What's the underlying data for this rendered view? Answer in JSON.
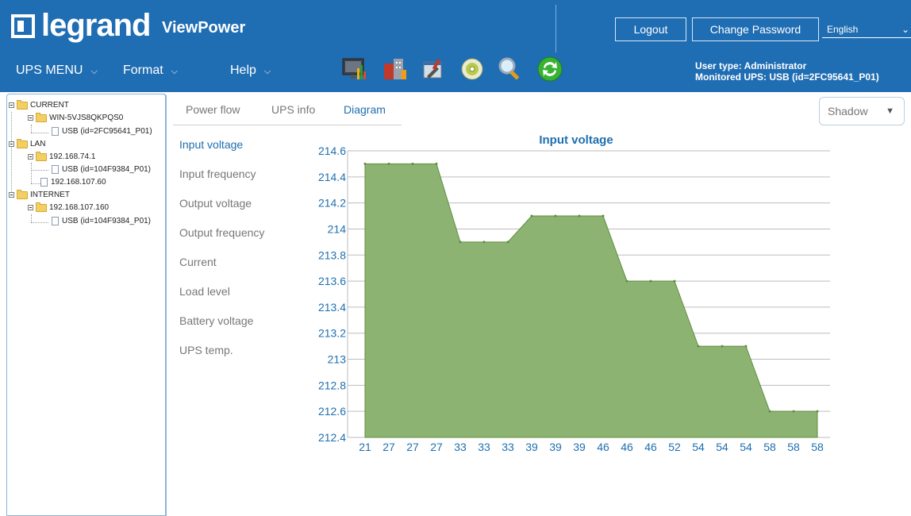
{
  "header": {
    "logo_text": "legrand",
    "app_name": "ViewPower",
    "logout_label": "Logout",
    "change_password_label": "Change Password",
    "language": "English",
    "user_type": "User type: Administrator",
    "monitored_ups": "Monitored UPS: USB (id=2FC95641_P01)"
  },
  "menu": {
    "ups_menu": "UPS MENU",
    "format": "Format",
    "help": "Help"
  },
  "toolbar_icons": [
    "monitor-chart-icon",
    "building-icon",
    "tools-icon",
    "disc-icon",
    "magnifier-icon",
    "refresh-icon"
  ],
  "tree": {
    "current": "CURRENT",
    "current_host": "WIN-5VJS8QKPQS0",
    "current_usb": "USB (id=2FC95641_P01)",
    "lan": "LAN",
    "lan_host1": "192.168.74.1",
    "lan_usb": "USB (id=104F9384_P01)",
    "lan_host2": "192.168.107.60",
    "internet": "INTERNET",
    "internet_host": "192.168.107.160",
    "internet_usb": "USB (id=104F9384_P01)"
  },
  "tabs": {
    "power_flow": "Power flow",
    "ups_info": "UPS info",
    "diagram": "Diagram"
  },
  "style_select": {
    "value": "Shadow"
  },
  "params": {
    "input_voltage": "Input voltage",
    "input_frequency": "Input frequency",
    "output_voltage": "Output voltage",
    "output_frequency": "Output frequency",
    "current": "Current",
    "load_level": "Load level",
    "battery_voltage": "Battery voltage",
    "ups_temp": "UPS temp."
  },
  "colors": {
    "header_bg": "#1f6db3",
    "accent": "#1e6fb0",
    "area_fill": "#8db373",
    "area_stroke": "#5f8f3e"
  },
  "chart_data": {
    "type": "area",
    "title": "Input voltage",
    "categories": [
      "21",
      "27",
      "27",
      "27",
      "33",
      "33",
      "33",
      "39",
      "39",
      "39",
      "46",
      "46",
      "46",
      "52",
      "54",
      "54",
      "54",
      "58",
      "58",
      "58"
    ],
    "values": [
      214.5,
      214.5,
      214.5,
      214.5,
      213.9,
      213.9,
      213.9,
      214.1,
      214.1,
      214.1,
      214.1,
      213.6,
      213.6,
      213.6,
      213.1,
      213.1,
      213.1,
      212.6,
      212.6,
      212.6
    ],
    "y_ticks": [
      "214.6",
      "214.4",
      "214.2",
      "214",
      "213.8",
      "213.6",
      "213.4",
      "213.2",
      "213",
      "212.8",
      "212.6",
      "212.4"
    ],
    "ylim": [
      212.4,
      214.6
    ],
    "grid": true,
    "legend": "none"
  }
}
